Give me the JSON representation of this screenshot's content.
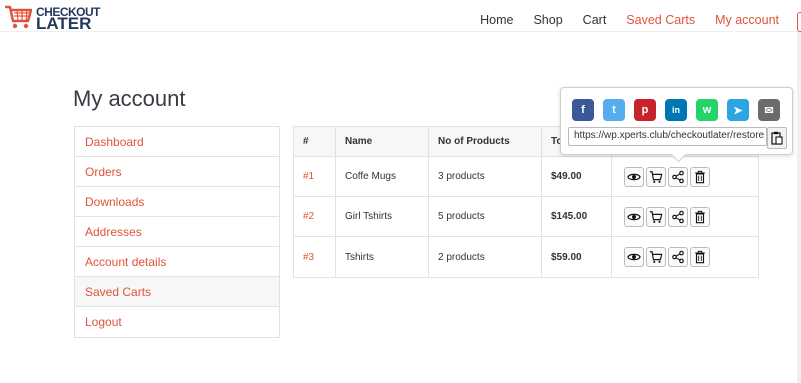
{
  "logo": {
    "line1": "CHECKOUT",
    "line2": "LATER",
    "color": "#e0533c"
  },
  "nav": {
    "items": [
      {
        "label": "Home",
        "active": false
      },
      {
        "label": "Shop",
        "active": false
      },
      {
        "label": "Cart",
        "active": false
      },
      {
        "label": "Saved Carts",
        "active": true
      },
      {
        "label": "My account",
        "active": true
      }
    ]
  },
  "page": {
    "title": "My account"
  },
  "account_nav": {
    "items": [
      {
        "label": "Dashboard"
      },
      {
        "label": "Orders"
      },
      {
        "label": "Downloads"
      },
      {
        "label": "Addresses"
      },
      {
        "label": "Account details"
      },
      {
        "label": "Saved Carts"
      },
      {
        "label": "Logout"
      }
    ]
  },
  "table": {
    "headers": [
      "#",
      "Name",
      "No of Products",
      "Total",
      ""
    ],
    "rows": [
      {
        "id": "#1",
        "name": "Coffe Mugs",
        "products": "3 products",
        "total": "$49.00"
      },
      {
        "id": "#2",
        "name": "Girl Tshirts",
        "products": "5 products",
        "total": "$145.00"
      },
      {
        "id": "#3",
        "name": "Tshirts",
        "products": "2 products",
        "total": "$59.00"
      }
    ]
  },
  "share": {
    "url": "https://wp.xperts.club/checkoutlater/restore",
    "networks": [
      {
        "name": "facebook-icon",
        "glyph": "f",
        "color": "#3b5998"
      },
      {
        "name": "twitter-icon",
        "glyph": "t",
        "color": "#55acee"
      },
      {
        "name": "pinterest-icon",
        "glyph": "p",
        "color": "#c8232c"
      },
      {
        "name": "linkedin-icon",
        "glyph": "in",
        "color": "#0077b5"
      },
      {
        "name": "whatsapp-icon",
        "glyph": "w",
        "color": "#25d366"
      },
      {
        "name": "telegram-icon",
        "glyph": "➤",
        "color": "#2ca5e0"
      },
      {
        "name": "email-icon",
        "glyph": "✉",
        "color": "#6b6b6b"
      }
    ]
  },
  "colors": {
    "accent": "#e0533c",
    "brand_dark": "#243a5a"
  }
}
